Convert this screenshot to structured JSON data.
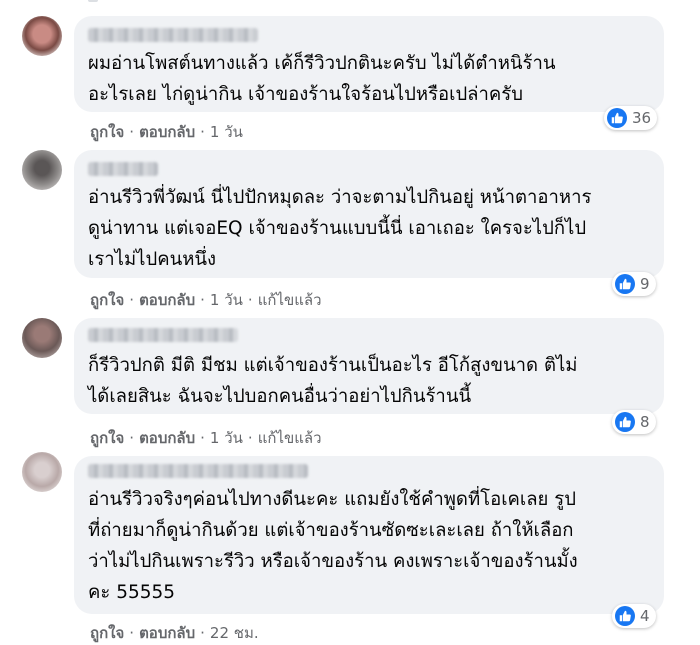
{
  "comments": [
    {
      "text": "ผมอ่านโพสต์นทางแล้ว เค้ก็รีวิวปกตินะครับ ไม่ได้ตำหนิร้าน\nอะไรเลย ไก่ดูน่ากิน เจ้าของร้านใจร้อนไปหรือเปล่าครับ",
      "like": "ถูกใจ",
      "reply": "ตอบกลับ",
      "time": "1 วัน",
      "edited": "",
      "reactions": "36"
    },
    {
      "text": "อ่านรีวิวพี่วัฒน์ นี่ไปปักหมุดละ ว่าจะตามไปกินอยู่ หน้าตาอาหาร\nดูน่าทาน แต่เจอEQ เจ้าของร้านแบบนี้นี่ เอาเถอะ ใครจะไปก็ไป\nเราไม่ไปคนหนึ่ง",
      "like": "ถูกใจ",
      "reply": "ตอบกลับ",
      "time": "1 วัน",
      "edited": "แก้ไขแล้ว",
      "reactions": "9"
    },
    {
      "text": "ก็รีวิวปกติ มีติ มีชม แต่เจ้าของร้านเป็นอะไร อีโก้สูงขนาด ติไม่\nได้เลยสินะ ฉันจะไปบอกคนอื่นว่าอย่าไปกินร้านนี้",
      "like": "ถูกใจ",
      "reply": "ตอบกลับ",
      "time": "1 วัน",
      "edited": "แก้ไขแล้ว",
      "reactions": "8"
    },
    {
      "text": "อ่านรีวิวจริงๆค่อนไปทางดีนะคะ แถมยังใช้คำพูดที่โอเคเลย รูป\nที่ถ่ายมาก็ดูน่ากินด้วย แต่เจ้าของร้านซัดซะเละเลย ถ้าให้เลือก\nว่าไม่ไปกินเพราะรีวิว หรือเจ้าของร้าน คงเพราะเจ้าของร้านมั้ง\nคะ 55555",
      "like": "ถูกใจ",
      "reply": "ตอบกลับ",
      "time": "22 ชม.",
      "edited": "",
      "reactions": "4"
    }
  ],
  "colors": {
    "bubble": "#f0f2f5",
    "like_blue": "#1877f2",
    "meta": "#65676b"
  },
  "icons": {
    "reaction": "like-thumb-icon"
  }
}
